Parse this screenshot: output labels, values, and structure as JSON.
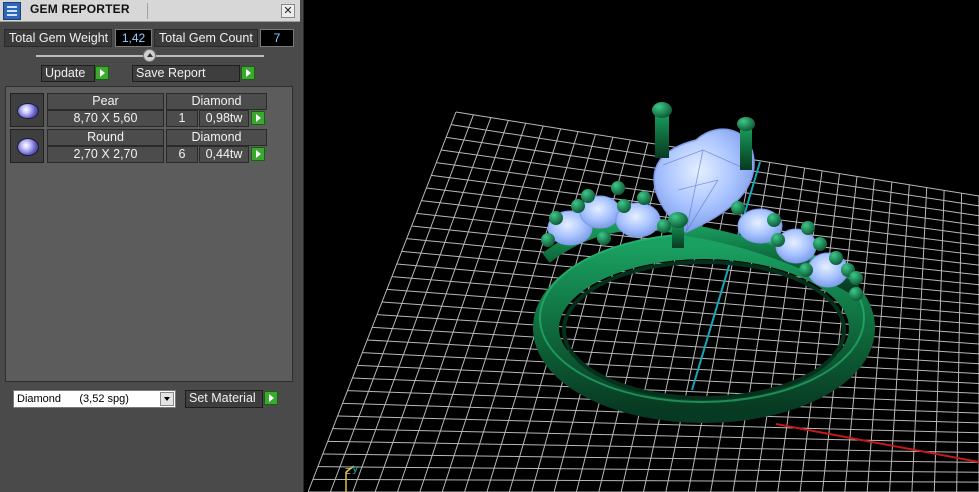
{
  "window": {
    "title": "GEM REPORTER",
    "close_glyph": "✕"
  },
  "stats": {
    "weight_label": "Total Gem Weight",
    "weight_value": "1,42",
    "count_label": "Total Gem Count",
    "count_value": "7"
  },
  "actions": {
    "update_label": "Update",
    "save_report_label": "Save Report"
  },
  "gems": [
    {
      "shape": "Pear",
      "material": "Diamond",
      "size": "8,70 X 5,60",
      "count": "1",
      "weight": "0,98tw"
    },
    {
      "shape": "Round",
      "material": "Diamond",
      "size": "2,70 X 2,70",
      "count": "6",
      "weight": "0,44tw"
    }
  ],
  "material": {
    "selected": "Diamond      (3,52 spg)",
    "set_label": "Set Material"
  },
  "viewport": {
    "axis_labels": [
      "z",
      "y"
    ],
    "colors": {
      "metal": "#0f6b3d",
      "stone": "#a9c4ff",
      "grid": "#d9d9d9",
      "y_axis": "#18a6b5",
      "x_axis": "#c41a1a"
    }
  }
}
